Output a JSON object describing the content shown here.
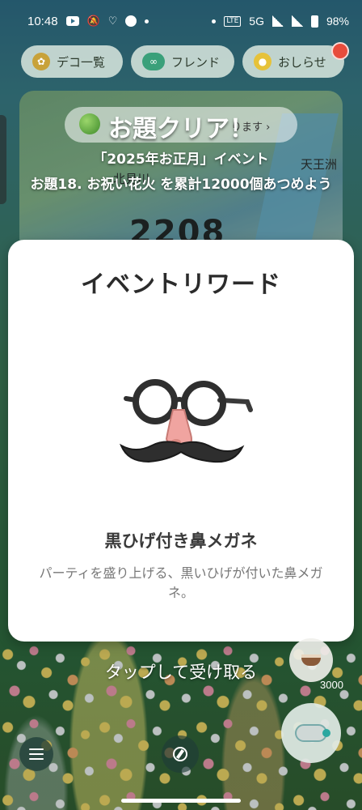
{
  "status_bar": {
    "time": "10:48",
    "network": "5G",
    "lte_badge": "LTE",
    "battery": "98%"
  },
  "top_bar": {
    "decor_label": "デコ一覧",
    "friend_label": "フレンド",
    "news_label": "おしらせ"
  },
  "background": {
    "place_label_1": "北見川",
    "place_label_2": "天王洲",
    "counter": "2208",
    "steps": "3000",
    "hidden_subtitle": "ります ›"
  },
  "clear": {
    "title": "お題クリア！",
    "event": "「2025年お正月」イベント",
    "task": "お題18. お祝い花火 を累計12000個あつめよう"
  },
  "reward": {
    "heading": "イベントリワード",
    "item_name": "黒ひげ付き鼻メガネ",
    "description": "パーティを盛り上げる、黒いひげが付いた鼻メガネ。"
  },
  "tap_prompt": "タップして受け取る",
  "colors": {
    "card_bg": "#ffffff",
    "notification": "#e74c3c"
  }
}
